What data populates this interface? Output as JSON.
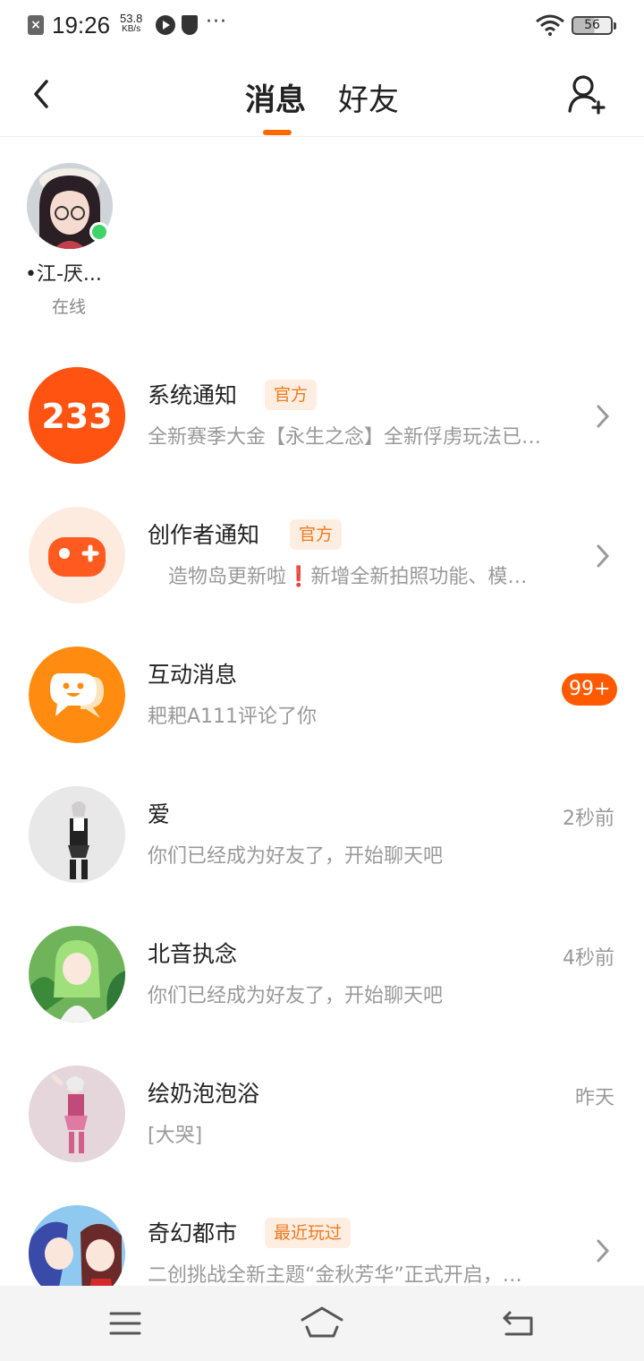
{
  "status_bar": {
    "time": "19:26",
    "speed_value": "53.8",
    "speed_unit": "KB/s",
    "dots": "···",
    "battery": "56"
  },
  "header": {
    "tabs": [
      {
        "label": "消息",
        "active": true
      },
      {
        "label": "好友",
        "active": false
      }
    ],
    "accent_color": "#ff6a00"
  },
  "online_friends": [
    {
      "name": "•江-厌...",
      "status": "在线"
    }
  ],
  "messages": [
    {
      "title": "系统通知",
      "badge": "官方",
      "preview": "全新赛季大金【永生之念】全新俘虏玩法已…",
      "avatar_text": "233",
      "has_chevron": true
    },
    {
      "title": "创作者通知",
      "badge": "官方",
      "preview": "造物岛更新啦❗新增全新拍照功能、模…",
      "avatar_icon": "gamepad-icon",
      "has_chevron": true
    },
    {
      "title": "互动消息",
      "preview": "耙耙A111评论了你",
      "count": "99+",
      "avatar_icon": "chat-smile-icon"
    },
    {
      "title": "爱",
      "preview": "你们已经成为好友了，开始聊天吧",
      "time": "2秒前"
    },
    {
      "title": "北音执念",
      "preview": "你们已经成为好友了，开始聊天吧",
      "time": "4秒前"
    },
    {
      "title": "绘奶泡泡浴",
      "preview": "[大哭]",
      "time": "昨天"
    },
    {
      "title": "奇幻都市",
      "badge": "最近玩过",
      "preview": "二创挑战全新主题“金秋芳华”正式开启，…",
      "has_chevron": true
    }
  ],
  "bottom_nav": {
    "items": [
      "menu-icon",
      "home-icon",
      "back-icon"
    ]
  }
}
